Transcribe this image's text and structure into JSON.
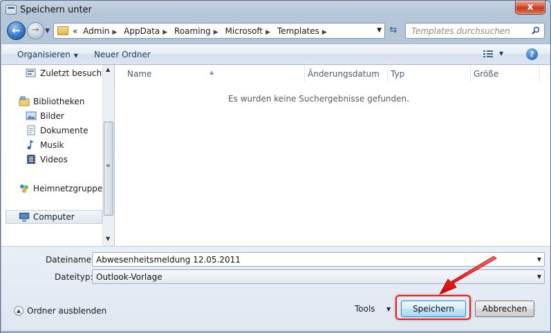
{
  "window": {
    "title": "Speichern unter",
    "close_label": "x"
  },
  "address": {
    "overflow_marker": "«",
    "crumbs": [
      "Admin",
      "AppData",
      "Roaming",
      "Microsoft",
      "Templates"
    ]
  },
  "search": {
    "placeholder": "Templates durchsuchen"
  },
  "toolbar": {
    "organize_label": "Organisieren",
    "new_folder_label": "Neuer Ordner",
    "help_label": "?"
  },
  "navpane": {
    "items": [
      {
        "label": "Zuletzt besucht",
        "icon": "recent-places-icon"
      },
      {
        "label": "Bibliotheken",
        "icon": "libraries-icon"
      },
      {
        "label": "Bilder",
        "icon": "pictures-icon"
      },
      {
        "label": "Dokumente",
        "icon": "documents-icon"
      },
      {
        "label": "Musik",
        "icon": "music-icon"
      },
      {
        "label": "Videos",
        "icon": "videos-icon"
      },
      {
        "label": "Heimnetzgruppe",
        "icon": "homegroup-icon"
      },
      {
        "label": "Computer",
        "icon": "computer-icon",
        "selected": true
      }
    ]
  },
  "filelist": {
    "columns": [
      "Name",
      "Änderungsdatum",
      "Typ",
      "Größe"
    ],
    "empty_message": "Es wurden keine Suchergebnisse gefunden."
  },
  "form": {
    "filename_label": "Dateiname:",
    "filename_value": "Abwesenheitsmeldung 12.05.2011",
    "filetype_label": "Dateityp:",
    "filetype_value": "Outlook-Vorlage",
    "hide_folders_label": "Ordner ausblenden",
    "tools_label": "Tools",
    "save_label": "Speichern",
    "cancel_label": "Abbrechen"
  },
  "colors": {
    "accent_highlight": "#e31c1c",
    "save_button_border": "#3c7fb1"
  }
}
